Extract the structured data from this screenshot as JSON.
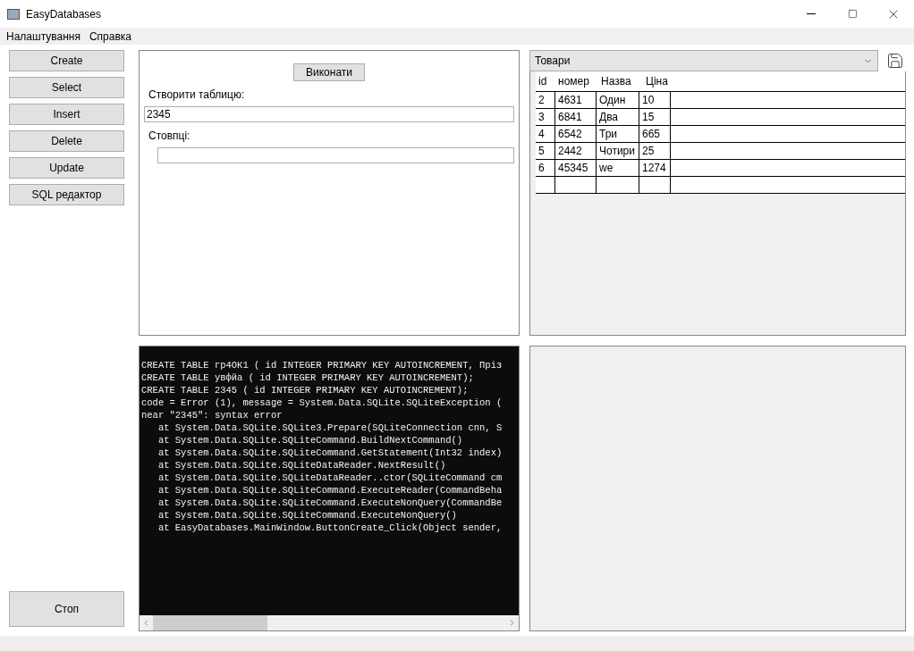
{
  "window": {
    "title": "EasyDatabases"
  },
  "menu": [
    "Налаштування",
    "Справка"
  ],
  "sidebar": {
    "buttons": [
      "Create",
      "Select",
      "Insert",
      "Delete",
      "Update",
      "SQL редактор"
    ],
    "stop_button": "Стоп"
  },
  "editor": {
    "run_button": "Виконати",
    "fields": [
      {
        "label": "Створити таблицю:",
        "value": "2345"
      },
      {
        "label": "Стовпці:"
      }
    ]
  },
  "table_view": {
    "table_select": "Товари",
    "columns": [
      "id",
      "номер",
      "Назва",
      "Ціна"
    ],
    "rows": [
      [
        "2",
        "4631",
        "Один",
        "10"
      ],
      [
        "3",
        "6841",
        "Два",
        "15"
      ],
      [
        "4",
        "6542",
        "Три",
        "665"
      ],
      [
        "5",
        "2442",
        "Чотири",
        "25"
      ],
      [
        "6",
        "45345",
        "we",
        "1274"
      ]
    ]
  },
  "console": {
    "lines": [
      "CREATE TABLE гр4ОК1 ( id INTEGER PRIMARY KEY AUTOINCREMENT, Пріз",
      "CREATE TABLE увфйа ( id INTEGER PRIMARY KEY AUTOINCREMENT);",
      "CREATE TABLE 2345 ( id INTEGER PRIMARY KEY AUTOINCREMENT);",
      "code = Error (1), message = System.Data.SQLite.SQLiteException (",
      "near \"2345\": syntax error",
      "   at System.Data.SQLite.SQLite3.Prepare(SQLiteConnection cnn, S",
      "   at System.Data.SQLite.SQLiteCommand.BuildNextCommand()",
      "   at System.Data.SQLite.SQLiteCommand.GetStatement(Int32 index)",
      "   at System.Data.SQLite.SQLiteDataReader.NextResult()",
      "   at System.Data.SQLite.SQLiteDataReader..ctor(SQLiteCommand cm",
      "   at System.Data.SQLite.SQLiteCommand.ExecuteReader(CommandBeha",
      "   at System.Data.SQLite.SQLiteCommand.ExecuteNonQuery(CommandBe",
      "   at System.Data.SQLite.SQLiteCommand.ExecuteNonQuery()",
      "   at EasyDatabases.MainWindow.ButtonCreate_Click(Object sender,"
    ]
  }
}
